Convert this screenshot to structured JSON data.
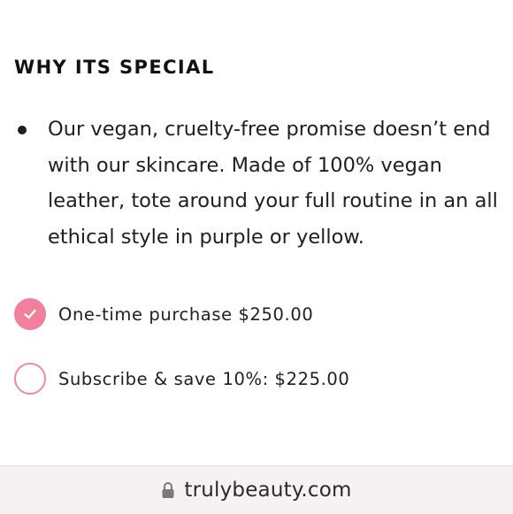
{
  "section": {
    "heading": "WHY ITS SPECIAL",
    "bullets": [
      "Our vegan, cruelty-free promise doesn’t end with our skincare. Made of 100% vegan leather, tote around your full routine in an all ethical style in purple or yellow."
    ]
  },
  "purchase_options": [
    {
      "label": "One-time purchase $250.00",
      "selected": true
    },
    {
      "label": "Subscribe & save 10%: $225.00",
      "selected": false
    }
  ],
  "browser": {
    "url": "trulybeauty.com",
    "lock_icon": "lock-icon"
  },
  "colors": {
    "accent": "#f0809c"
  }
}
